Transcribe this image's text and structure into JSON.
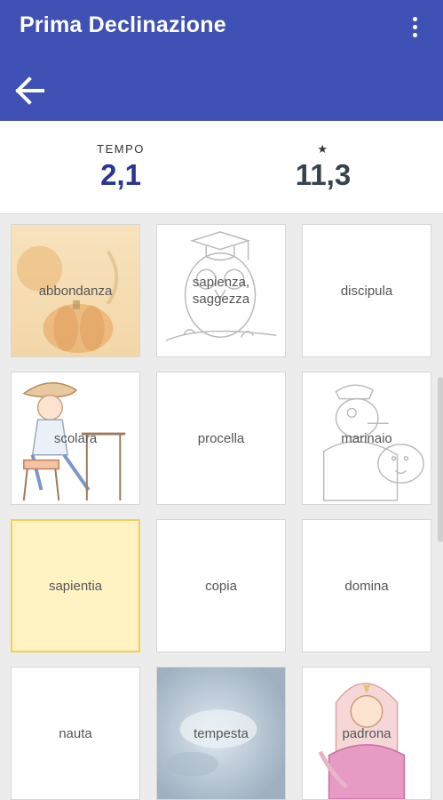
{
  "appbar": {
    "title": "Prima Declinazione",
    "color": "#3f51b5",
    "icons": [
      "more-vert-icon",
      "arrow-back-icon"
    ]
  },
  "stats": {
    "time_label": "TEMPO",
    "time_value": "2,1",
    "score_label": "★",
    "score_value": "11,3"
  },
  "cards": [
    {
      "word": "abbondanza",
      "image": "pumpkin-autumn-photo"
    },
    {
      "word": "sapienza, saggezza",
      "image": "owl-graduate-drawing"
    },
    {
      "word": "discipula",
      "image": ""
    },
    {
      "word": "scolara",
      "image": "schoolgirl-drawing"
    },
    {
      "word": "procella",
      "image": ""
    },
    {
      "word": "marinaio",
      "image": "sailor-drawing"
    },
    {
      "word": "sapientia",
      "image": "",
      "selected": true
    },
    {
      "word": "copia",
      "image": ""
    },
    {
      "word": "domina",
      "image": ""
    },
    {
      "word": "nauta",
      "image": ""
    },
    {
      "word": "tempesta",
      "image": "storm-photo"
    },
    {
      "word": "padrona",
      "image": "lady-drawing"
    }
  ],
  "colors": {
    "selected_fill": "#fff3c4",
    "selected_border": "#f2cf57",
    "time_value": "#283593"
  }
}
